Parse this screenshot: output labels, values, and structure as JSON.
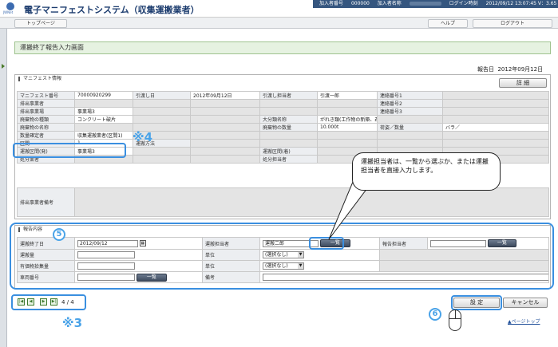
{
  "header": {
    "logo_text": "JWNet",
    "app_title": "電子マニフェストシステム（収集運搬業者）",
    "subscriber_no_label": "加入者番号",
    "subscriber_no": "000000",
    "subscriber_name_label": "加入者名称",
    "login_time_label": "ログイン時刻",
    "login_time": "2012/09/12 13:07:45 V：3.65"
  },
  "nav": {
    "top_page": "トップページ",
    "help": "ヘルプ",
    "logout": "ログアウト"
  },
  "page_title": "運搬終了報告入力画面",
  "report_date": {
    "label": "報告日",
    "value": "2012年09月12日"
  },
  "manifest": {
    "section_title": "マニフェスト情報",
    "detail_button": "詳 細",
    "rows": [
      [
        "マニフェスト番号",
        "70000920299",
        "引渡し日",
        "2012年09月12日",
        "引渡し担当者",
        "引渡一郎",
        "連絡番号1",
        ""
      ],
      [
        "排出事業者",
        "",
        "",
        "",
        "",
        "",
        "連絡番号2",
        ""
      ],
      [
        "排出事業場",
        "事業場3",
        "",
        "",
        "",
        "",
        "連絡番号3",
        ""
      ],
      [
        "廃棄物の種類",
        "コンクリート破片",
        "",
        "",
        "大分類名称",
        "がれき類(工作物の新築、改築又は除去に伴って生じた不要物)",
        "",
        ""
      ],
      [
        "廃棄物の名称",
        "",
        "",
        "",
        "廃棄物の数量",
        "10.000t",
        "荷姿／数量",
        "バラ／"
      ],
      [
        "数量確定者",
        "収集運搬業者(区間1)",
        "",
        "",
        "",
        "",
        "",
        ""
      ],
      [
        "区間",
        "1",
        "運搬方法",
        "",
        "",
        "",
        "",
        ""
      ],
      [
        "運搬区間(発)",
        "事業場3",
        "",
        "",
        "運搬区間(着)",
        "",
        "",
        ""
      ],
      [
        "処分業者",
        "",
        "",
        "",
        "処分担当者",
        "",
        "",
        ""
      ]
    ],
    "remarks_label": "排出事業者備考"
  },
  "report": {
    "section_title": "報告内容",
    "end_date_label": "運搬終了日",
    "end_date": "2012/09/12",
    "transporter_label": "運搬担当者",
    "transporter_value": "運搬二郎",
    "list_button": "一覧",
    "reporter_label": "報告担当者",
    "quantity_label": "運搬量",
    "unit_label": "単位",
    "unit_value": "(選択なし)",
    "valuable_label": "有価物拾集量",
    "vehicle_label": "車両番号",
    "notes_label": "備考"
  },
  "pagination": {
    "first": "|◀",
    "prev": "◀",
    "next": "▶",
    "last": "▶|",
    "current": "4",
    "sep": "/",
    "total": "4"
  },
  "actions": {
    "confirm": "設 定",
    "cancel": "キャンセル",
    "page_top": "▲ページトップ"
  },
  "annotations": {
    "mark4": "※4",
    "mark3": "※3",
    "num5": "5",
    "num6": "6",
    "bubble": "運搬担当者は、一覧から選ぶか、または運搬担当者を直接入力します。"
  }
}
